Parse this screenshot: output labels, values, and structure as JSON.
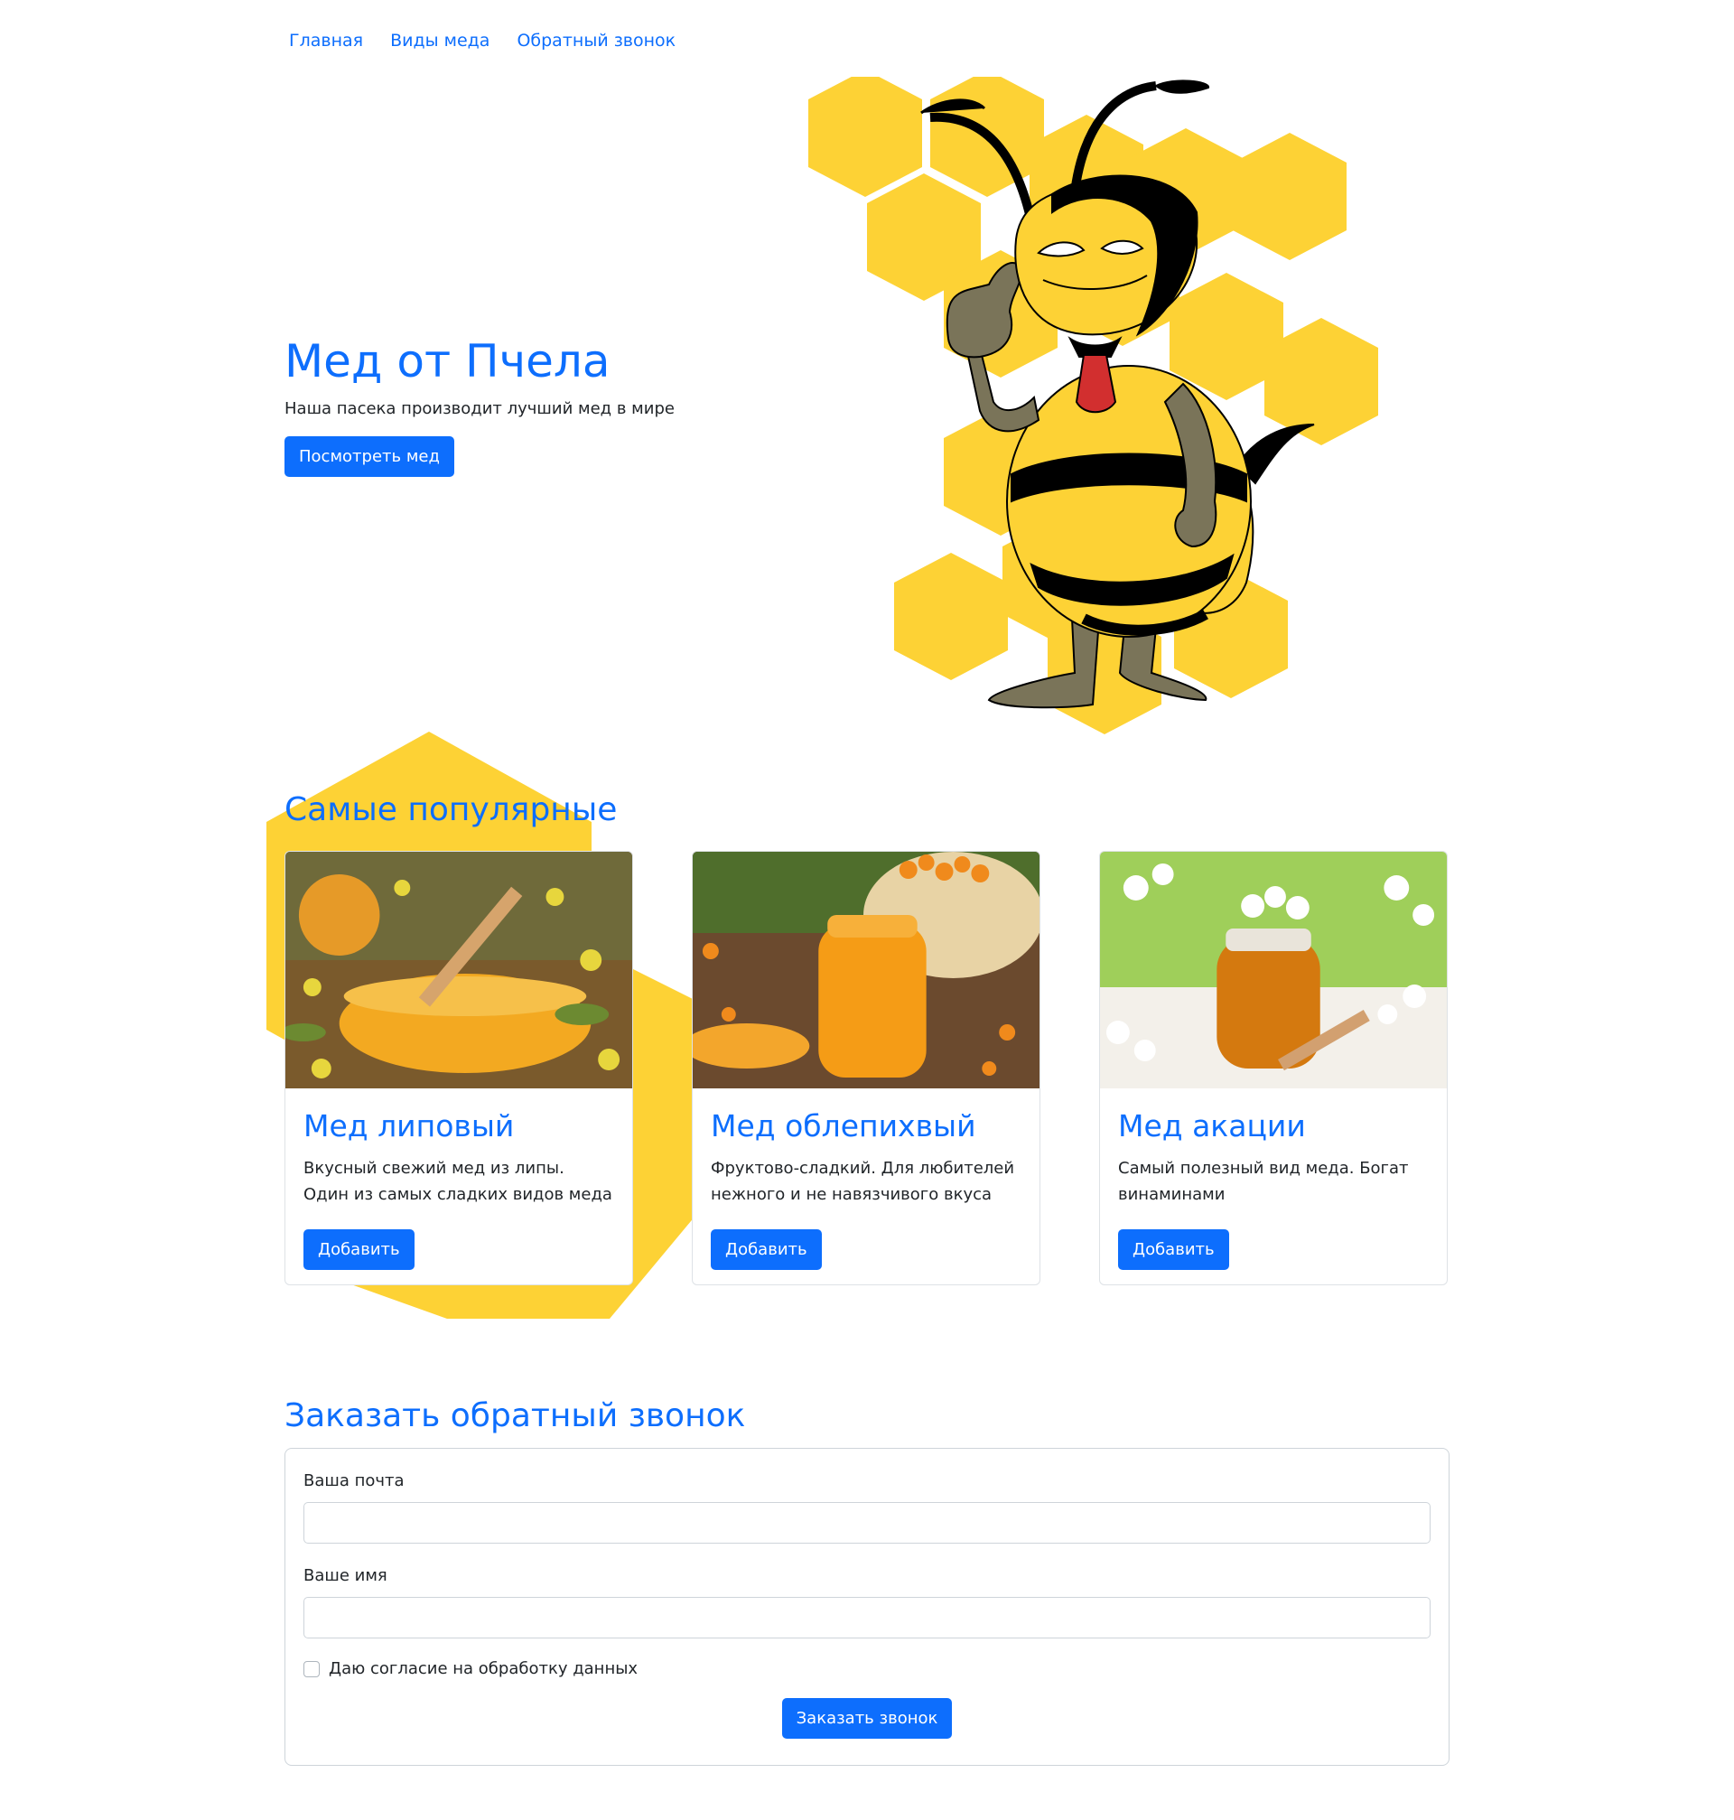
{
  "nav": {
    "items": [
      {
        "label": "Главная"
      },
      {
        "label": "Виды меда"
      },
      {
        "label": "Обратный звонок"
      }
    ]
  },
  "hero": {
    "title": "Мед от Пчела",
    "subtitle": "Наша пасека производит лучший мед в мире",
    "button_label": "Посмотреть мед"
  },
  "popular": {
    "title": "Самые популярные",
    "cards": [
      {
        "title": "Мед липовый",
        "text": "Вкусный свежий мед из липы. Один из самых сладких видов меда",
        "button_label": "Добавить"
      },
      {
        "title": "Мед облепихвый",
        "text": "Фруктово-сладкий. Для любителей нежного и не навязчивого вкуса",
        "button_label": "Добавить"
      },
      {
        "title": "Мед акации",
        "text": "Самый полезный вид меда. Богат винаминами",
        "button_label": "Добавить"
      }
    ]
  },
  "callback": {
    "title": "Заказать обратный звонок",
    "email_label": "Ваша почта",
    "email_value": "",
    "name_label": "Ваше имя",
    "name_value": "",
    "consent_label": "Даю согласие на обработку данных",
    "consent_checked": false,
    "submit_label": "Заказать звонок"
  },
  "colors": {
    "accent": "#0d6efd",
    "honeycomb": "#fdd235",
    "bee_limb": "#7a7459",
    "tie": "#d22f2f"
  }
}
